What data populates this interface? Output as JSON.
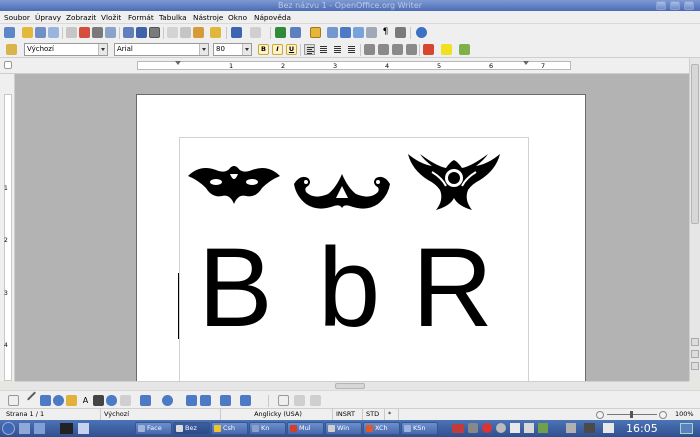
{
  "window": {
    "title": "Bez názvu 1 - OpenOffice.org Writer"
  },
  "menu": [
    "Soubor",
    "Úpravy",
    "Zobrazit",
    "Vložit",
    "Formát",
    "Tabulka",
    "Nástroje",
    "Okno",
    "Nápověda"
  ],
  "format": {
    "style": "Výchozí",
    "font": "Arial",
    "size": "80",
    "bold": "B",
    "italic": "I",
    "underline": "U"
  },
  "ruler": {
    "numbers": [
      "1",
      "2",
      "3",
      "4",
      "5",
      "6",
      "7"
    ],
    "vertical_numbers": [
      "1",
      "2",
      "3",
      "4"
    ]
  },
  "document": {
    "letters": [
      "B",
      "b",
      "R"
    ],
    "ornaments": [
      "mask-ornament",
      "scroll-ornament",
      "winged-emblem-ornament"
    ]
  },
  "status": {
    "page": "Strana 1 / 1",
    "style": "Výchozí",
    "language": "Anglicky (USA)",
    "mode": "INSRT",
    "selection": "STD",
    "asterisk": "*",
    "zoom": "100%"
  },
  "taskbar": {
    "items": [
      "Face",
      "Bez",
      "Csh",
      "Kn",
      "Mul",
      "Win",
      "XCh",
      "KSn"
    ],
    "clock": "16:05"
  },
  "colors": {
    "titlebar": "#4c6bb4",
    "taskbar": "#2f4f8f",
    "workspace": "#b3b3b3",
    "highlight": "#fff3c6"
  }
}
